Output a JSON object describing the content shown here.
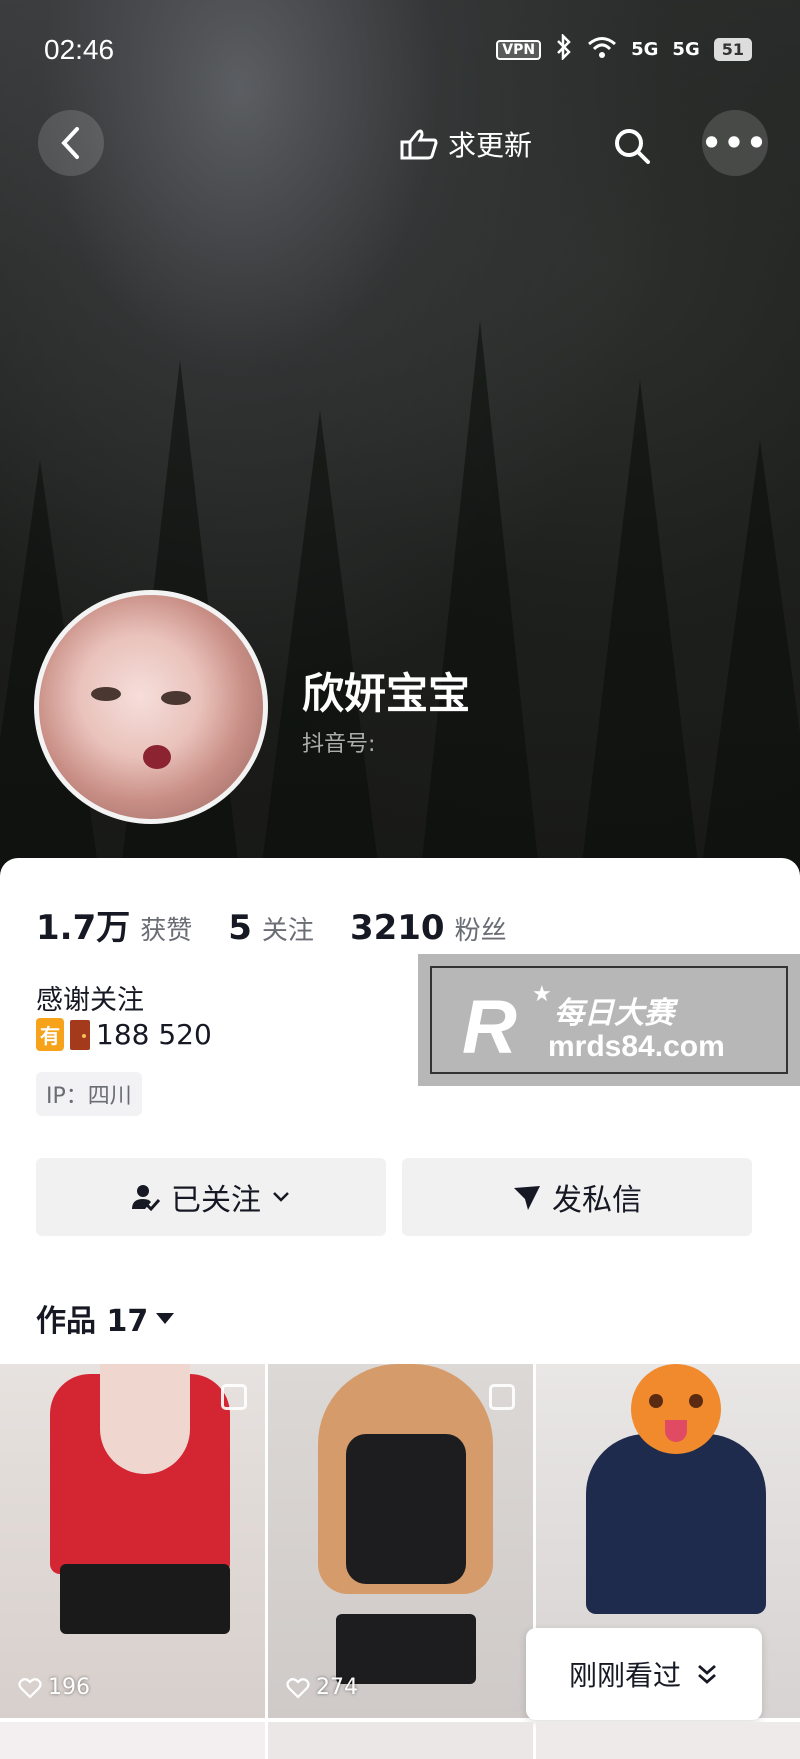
{
  "status_bar": {
    "time": "02:46",
    "vpn": "VPN",
    "sig1": "5G",
    "sig2": "5G",
    "battery": "51"
  },
  "nav": {
    "update_label": "求更新"
  },
  "profile": {
    "nickname": "欣妍宝宝",
    "douyin_id_label": "抖音号:",
    "stats": [
      {
        "num": "1.7万",
        "label": "获赞"
      },
      {
        "num": "5",
        "label": "关注"
      },
      {
        "num": "3210",
        "label": "粉丝"
      }
    ],
    "bio": "感谢关注",
    "fan_badge": "有",
    "fan_number": "188 520",
    "ip": "IP：四川"
  },
  "watermark": {
    "logo": "R",
    "cn": "每日大赛",
    "url": "mrds84.com"
  },
  "buttons": {
    "followed": "已关注",
    "message": "发私信"
  },
  "works": {
    "label": "作品 17",
    "items": [
      {
        "likes": "196"
      },
      {
        "likes": "274"
      },
      {
        "likes": ""
      }
    ]
  },
  "recent": {
    "label": "刚刚看过"
  },
  "colors": {
    "accent_text": "#161823",
    "muted": "#6b6d75",
    "badge": "#f6a21a"
  }
}
